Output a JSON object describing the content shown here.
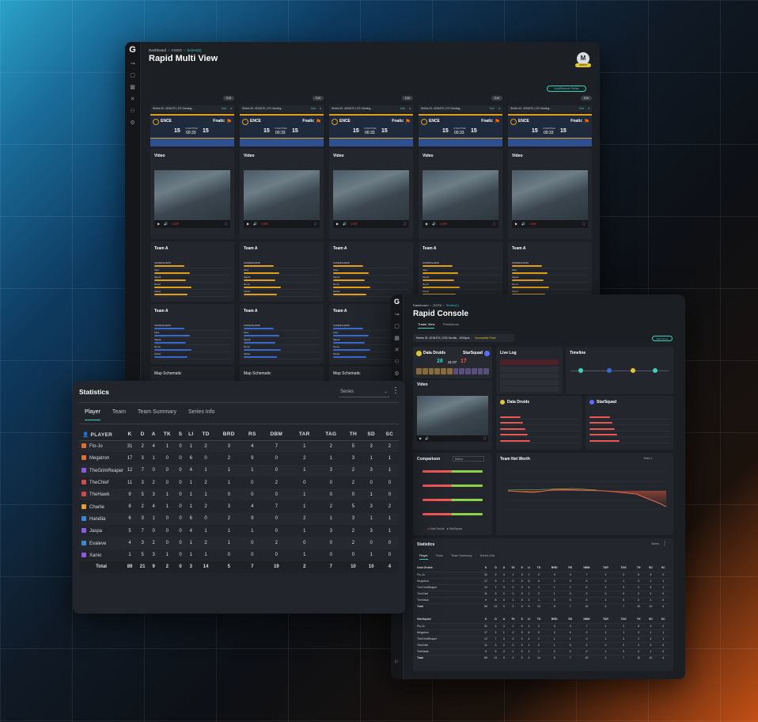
{
  "multi": {
    "breadcrumb": [
      "Dashboard",
      "CSGO",
      "Series(5)"
    ],
    "title": "Rapid Multi View",
    "user_initial": "M",
    "user_badge": "Admin",
    "add_button": "Add/Remove Series",
    "edit_label": "Edit",
    "series_header": "Series ID: 4216470",
    "series_game": "CS Gaming...",
    "live": "Live",
    "team1": "ENCE",
    "team2": "Fnatic",
    "score1": "15",
    "score2": "15",
    "round_label": "OVERTIME",
    "clock": "00:33",
    "video_title": "Video",
    "video_live": "LIVE",
    "team_a": "Team A",
    "map_title": "Map Schematic",
    "player_names": [
      "SUPERSHAMS",
      "Flow",
      "Signal",
      "Nemo",
      "Kaiser"
    ],
    "columns": 5
  },
  "stats": {
    "title": "Statistics",
    "dropdown": "Series",
    "tabs": [
      "Player",
      "Team",
      "Team Summary",
      "Series Info"
    ],
    "headers": [
      "PLAYER",
      "K",
      "D",
      "A",
      "TK",
      "S",
      "LI",
      "TD",
      "BRD",
      "RS",
      "DBM",
      "TAR",
      "TAG",
      "TH",
      "SD",
      "SC"
    ],
    "rows": [
      {
        "name": "Flo-Jo",
        "vals": [
          "31",
          "2",
          "4",
          "1",
          "0",
          "1",
          "2",
          "3",
          "4",
          "7",
          "1",
          "2",
          "5",
          "3",
          "2"
        ]
      },
      {
        "name": "Megatron",
        "vals": [
          "17",
          "3",
          "1",
          "0",
          "0",
          "6",
          "0",
          "2",
          "9",
          "0",
          "2",
          "1",
          "3",
          "1",
          "1"
        ]
      },
      {
        "name": "TheGrimReaper",
        "vals": [
          "12",
          "7",
          "0",
          "0",
          "0",
          "4",
          "1",
          "1",
          "1",
          "0",
          "1",
          "3",
          "2",
          "3",
          "1"
        ]
      },
      {
        "name": "TheChief",
        "vals": [
          "11",
          "3",
          "2",
          "0",
          "0",
          "1",
          "2",
          "1",
          "0",
          "2",
          "0",
          "0",
          "2",
          "0",
          "0"
        ]
      },
      {
        "name": "TheHawk",
        "vals": [
          "9",
          "5",
          "3",
          "1",
          "0",
          "1",
          "1",
          "0",
          "0",
          "0",
          "1",
          "0",
          "0",
          "1",
          "0"
        ]
      },
      {
        "name": "Charlie",
        "vals": [
          "8",
          "2",
          "4",
          "1",
          "0",
          "1",
          "2",
          "3",
          "4",
          "7",
          "1",
          "2",
          "5",
          "3",
          "2"
        ]
      },
      {
        "name": "Handila",
        "vals": [
          "6",
          "3",
          "1",
          "0",
          "0",
          "6",
          "0",
          "2",
          "9",
          "0",
          "2",
          "1",
          "3",
          "1",
          "1"
        ]
      },
      {
        "name": "Jaspa",
        "vals": [
          "5",
          "7",
          "0",
          "0",
          "0",
          "4",
          "1",
          "1",
          "1",
          "0",
          "1",
          "3",
          "2",
          "3",
          "1"
        ]
      },
      {
        "name": "Evaleve",
        "vals": [
          "4",
          "3",
          "2",
          "0",
          "0",
          "1",
          "2",
          "1",
          "0",
          "2",
          "0",
          "0",
          "2",
          "0",
          "0"
        ]
      },
      {
        "name": "Xanio",
        "vals": [
          "1",
          "5",
          "3",
          "1",
          "0",
          "1",
          "1",
          "0",
          "0",
          "0",
          "1",
          "0",
          "0",
          "1",
          "0"
        ]
      }
    ],
    "total": {
      "name": "Total",
      "vals": [
        "89",
        "21",
        "9",
        "2",
        "0",
        "3",
        "14",
        "5",
        "7",
        "19",
        "2",
        "7",
        "10",
        "10",
        "4"
      ]
    }
  },
  "console": {
    "breadcrumb": [
      "Dashboard",
      "DOTA",
      "Series(1)"
    ],
    "title": "Rapid Console",
    "tabs": [
      "Trader View",
      "Predictions"
    ],
    "series_label": "Series ID: 4216470 | CS2 Scrolls - 1000pcs",
    "incomplete": "Incomplete Feed",
    "edit_btn": "Edit Series",
    "team1": "Data Druids",
    "team2": "StarSquad",
    "score1": "28",
    "score2": "17",
    "clock": "31:07",
    "live_log": "Live Log",
    "timeline": "Timeline",
    "video_title": "Video",
    "comparison": "Comparison",
    "comparison_select": "Select",
    "net_worth": "Team Net Worth",
    "net_worth_select": "Team 1",
    "statistics": "Statistics",
    "series_dd": "Series",
    "stat_tabs": [
      "Player",
      "Team",
      "Team Summary",
      "Series Info"
    ],
    "legend": [
      "Data Druids",
      "StarSquad"
    ],
    "col_heads": [
      "K",
      "D",
      "A",
      "TK",
      "S",
      "LI",
      "TD",
      "BRD",
      "RS",
      "DBM",
      "TAR",
      "TAG",
      "TH",
      "SD",
      "SC"
    ],
    "team_a_name": "Data Druids",
    "team_b_name": "StarSquad",
    "total_label": "Total"
  },
  "colors": {
    "accent": "#3ad1c0",
    "ence": "#e2a019",
    "fnatic": "#ff6a00",
    "bg_dark": "#1a1d22",
    "card": "#23272d"
  }
}
